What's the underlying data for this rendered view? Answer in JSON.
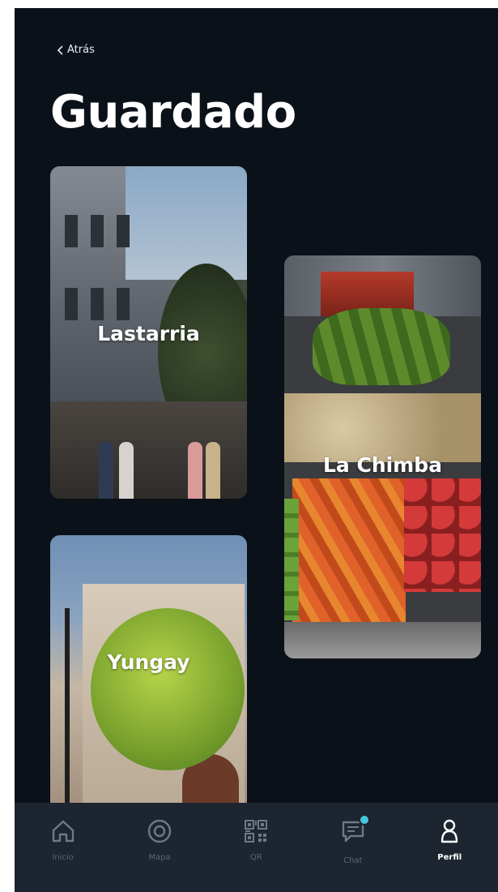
{
  "header": {
    "back_label": "Atrás",
    "title": "Guardado"
  },
  "cards": [
    {
      "label": "Lastarria"
    },
    {
      "label": "La Chimba"
    },
    {
      "label": "Yungay"
    }
  ],
  "nav": {
    "items": [
      {
        "label": "Inicio",
        "icon": "home-icon"
      },
      {
        "label": "Mapa",
        "icon": "target-icon"
      },
      {
        "label": "QR",
        "icon": "qr-code-icon"
      },
      {
        "label": "Chat",
        "icon": "chat-icon"
      },
      {
        "label": "Perfil",
        "icon": "profile-icon"
      }
    ],
    "active": "Perfil"
  },
  "colors": {
    "background": "#0b1119",
    "nav_background": "#1c2530",
    "chat_badge": "#45c7e0"
  }
}
